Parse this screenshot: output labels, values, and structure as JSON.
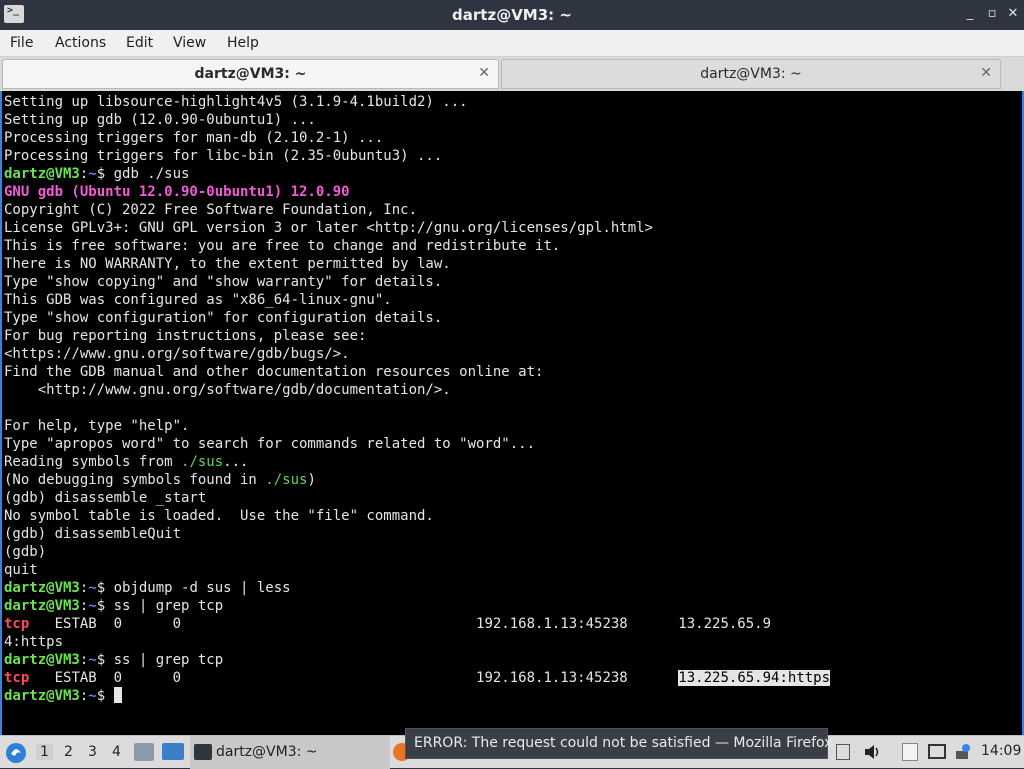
{
  "window": {
    "title": "dartz@VM3: ~"
  },
  "menu": [
    "File",
    "Actions",
    "Edit",
    "View",
    "Help"
  ],
  "tabs": [
    {
      "label": "dartz@VM3: ~"
    },
    {
      "label": "dartz@VM3: ~"
    }
  ],
  "terminal": {
    "lines": [
      [
        {
          "t": "Setting up libsource-highlight4v5 (3.1.9-4.1build2) ..."
        }
      ],
      [
        {
          "t": "Setting up gdb (12.0.90-0ubuntu1) ..."
        }
      ],
      [
        {
          "t": "Processing triggers for man-db (2.10.2-1) ..."
        }
      ],
      [
        {
          "t": "Processing triggers for libc-bin (2.35-0ubuntu3) ..."
        }
      ],
      [
        {
          "t": "dartz@VM3",
          "c": "pu"
        },
        {
          "t": ":"
        },
        {
          "t": "~",
          "c": "pp"
        },
        {
          "t": "$ gdb ./sus"
        }
      ],
      [
        {
          "t": "GNU gdb (Ubuntu 12.0.90-0ubuntu1) 12.0.90",
          "c": "mag"
        }
      ],
      [
        {
          "t": "Copyright (C) 2022 Free Software Foundation, Inc."
        }
      ],
      [
        {
          "t": "License GPLv3+: GNU GPL version 3 or later <http://gnu.org/licenses/gpl.html>"
        }
      ],
      [
        {
          "t": "This is free software: you are free to change and redistribute it."
        }
      ],
      [
        {
          "t": "There is NO WARRANTY, to the extent permitted by law."
        }
      ],
      [
        {
          "t": "Type \"show copying\" and \"show warranty\" for details."
        }
      ],
      [
        {
          "t": "This GDB was configured as \"x86_64-linux-gnu\"."
        }
      ],
      [
        {
          "t": "Type \"show configuration\" for configuration details."
        }
      ],
      [
        {
          "t": "For bug reporting instructions, please see:"
        }
      ],
      [
        {
          "t": "<https://www.gnu.org/software/gdb/bugs/>."
        }
      ],
      [
        {
          "t": "Find the GDB manual and other documentation resources online at:"
        }
      ],
      [
        {
          "t": "    <http://www.gnu.org/software/gdb/documentation/>."
        }
      ],
      [
        {
          "t": ""
        }
      ],
      [
        {
          "t": "For help, type \"help\"."
        }
      ],
      [
        {
          "t": "Type \"apropos word\" to search for commands related to \"word\"..."
        }
      ],
      [
        {
          "t": "Reading symbols from "
        },
        {
          "t": "./sus",
          "c": "grn"
        },
        {
          "t": "..."
        }
      ],
      [
        {
          "t": "(No debugging symbols found in "
        },
        {
          "t": "./sus",
          "c": "grn"
        },
        {
          "t": ")"
        }
      ],
      [
        {
          "t": "(gdb) disassemble _start"
        }
      ],
      [
        {
          "t": "No symbol table is loaded.  Use the \"file\" command."
        }
      ],
      [
        {
          "t": "(gdb) disassembleQuit"
        }
      ],
      [
        {
          "t": "(gdb)"
        }
      ],
      [
        {
          "t": "quit"
        }
      ],
      [
        {
          "t": "dartz@VM3",
          "c": "pu"
        },
        {
          "t": ":"
        },
        {
          "t": "~",
          "c": "pp"
        },
        {
          "t": "$ objdump -d sus | less"
        }
      ],
      [
        {
          "t": "dartz@VM3",
          "c": "pu"
        },
        {
          "t": ":"
        },
        {
          "t": "~",
          "c": "pp"
        },
        {
          "t": "$ ss | grep tcp"
        }
      ],
      [
        {
          "t": "tcp",
          "c": "red"
        },
        {
          "t": "   ESTAB  0      0                                   192.168.1.13:45238      13.225.65.9"
        }
      ],
      [
        {
          "t": "4:https"
        }
      ],
      [
        {
          "t": "dartz@VM3",
          "c": "pu"
        },
        {
          "t": ":"
        },
        {
          "t": "~",
          "c": "pp"
        },
        {
          "t": "$ ss | grep tcp"
        }
      ],
      [
        {
          "t": "tcp",
          "c": "red"
        },
        {
          "t": "   ESTAB  0      0                                   192.168.1.13:45238      "
        },
        {
          "t": "13.225.65.94:https",
          "c": "sel"
        }
      ],
      [
        {
          "t": "dartz@VM3",
          "c": "pu"
        },
        {
          "t": ":"
        },
        {
          "t": "~",
          "c": "pp"
        },
        {
          "t": "$ "
        },
        {
          "t": "",
          "c": "cursor"
        }
      ]
    ]
  },
  "taskbar": {
    "workspaces": [
      "1",
      "2",
      "3",
      "4"
    ],
    "active_task": "dartz@VM3: ~",
    "tooltip": "ERROR: The request could not be satisfied — Mozilla Firefox",
    "clock": "14:09"
  }
}
